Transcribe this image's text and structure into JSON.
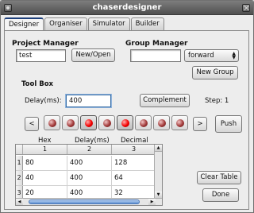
{
  "window": {
    "title": "chaserdesigner"
  },
  "tabs": [
    {
      "label": "Designer"
    },
    {
      "label": "Organiser"
    },
    {
      "label": "Simulator"
    },
    {
      "label": "Builder"
    }
  ],
  "project": {
    "label": "Project Manager",
    "value": "test",
    "button": "New/Open"
  },
  "group": {
    "label": "Group Manager",
    "value": "",
    "select_value": "forward",
    "button": "New Group"
  },
  "toolbox": {
    "label": "Tool Box",
    "delay_label": "Delay(ms):",
    "delay_value": "400",
    "complement_button": "Complement",
    "step_label": "Step:",
    "step_value": "1",
    "prev_button": "<",
    "next_button": ">",
    "push_button": "Push",
    "leds": [
      {
        "state": "dim"
      },
      {
        "state": "dim"
      },
      {
        "state": "on"
      },
      {
        "state": "dim"
      },
      {
        "state": "on"
      },
      {
        "state": "dim"
      },
      {
        "state": "dim"
      },
      {
        "state": "dim"
      }
    ],
    "colors": {
      "led_on": "#f40000",
      "led_dim": "#a23a3a"
    }
  },
  "table": {
    "headers": [
      "Hex",
      "Delay(ms)",
      "Decimal"
    ],
    "col_numbers": [
      "1",
      "2",
      "3"
    ],
    "rows": [
      {
        "num": "1",
        "cells": [
          "80",
          "400",
          "128"
        ]
      },
      {
        "num": "2",
        "cells": [
          "40",
          "400",
          "64"
        ]
      },
      {
        "num": "3",
        "cells": [
          "20",
          "400",
          "32"
        ]
      }
    ]
  },
  "actions": {
    "clear_table": "Clear Table",
    "done": "Done"
  }
}
